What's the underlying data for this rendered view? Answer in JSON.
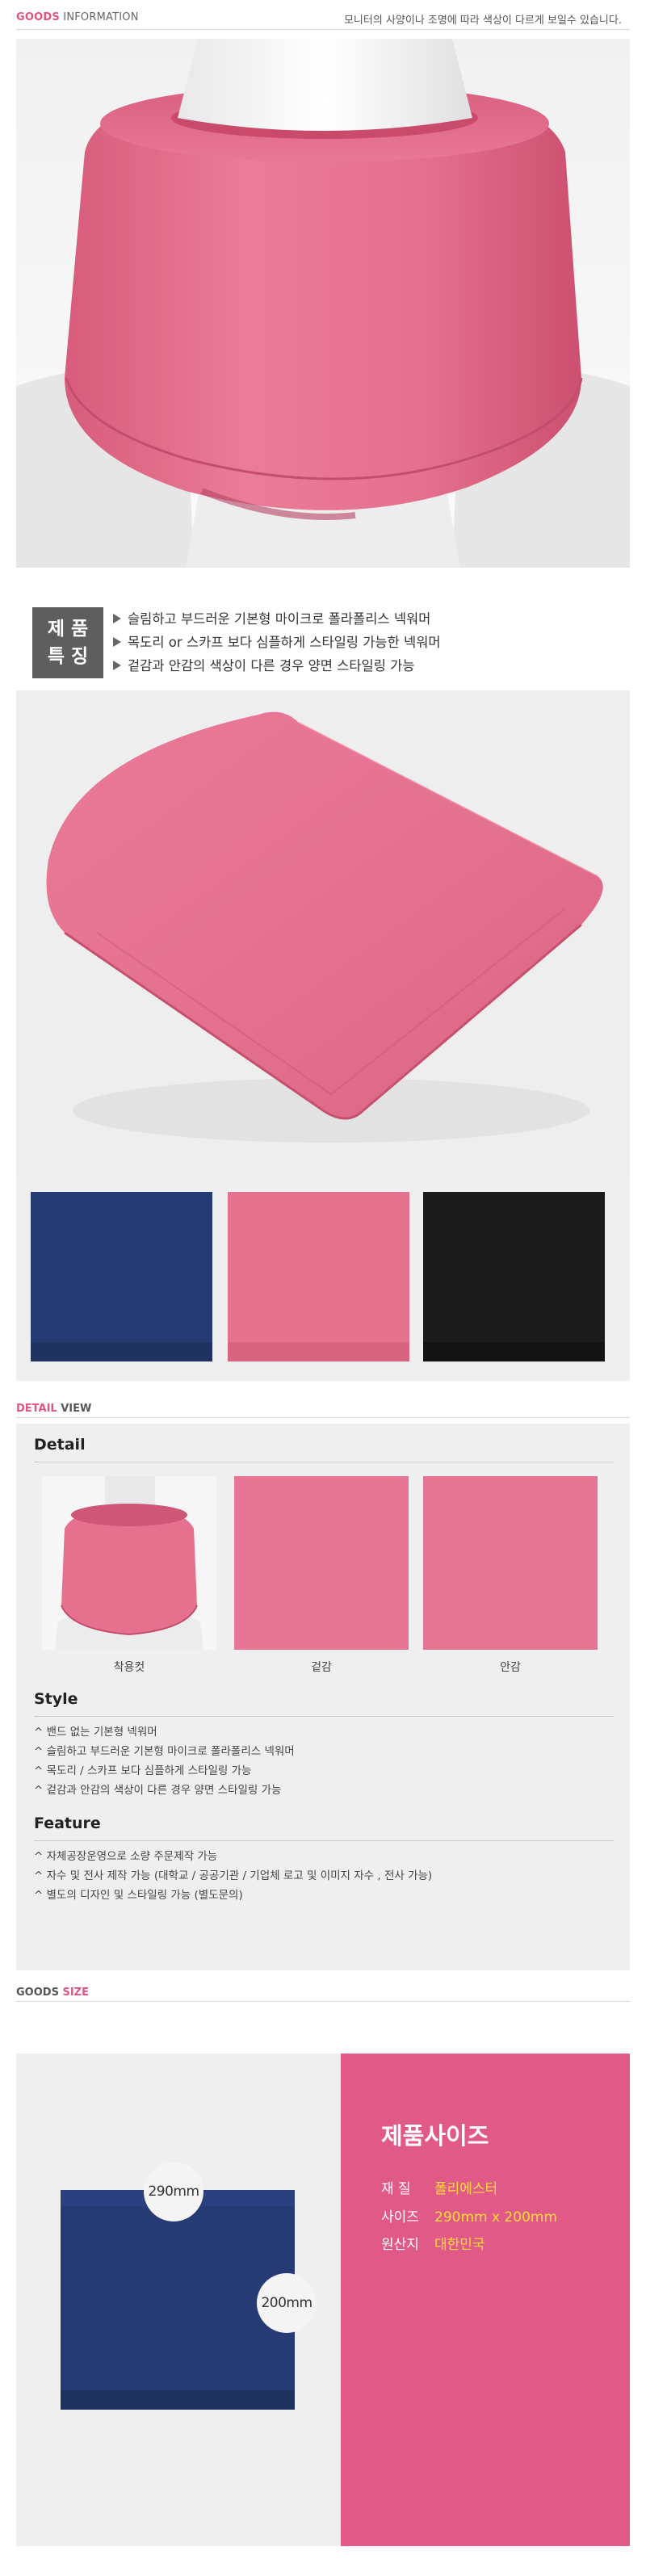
{
  "header": {
    "goods_label": "GOODS",
    "info_label": "INFORMATION",
    "notice": "모니터의 사양이나 조명에 따라 색상이 다르게 보일수 있습니다."
  },
  "features": {
    "badge_line1": "제 품",
    "badge_line2": "특 징",
    "items": [
      "슬림하고 부드러운 기본형 마이크로 폴라폴리스 넥워머",
      "목도리 or 스카프 보다 심플하게 스타일링 가능한 넥워머",
      "겉감과 안감의 색상이 다른 경우 양면 스타일링 가능"
    ]
  },
  "swatches": [
    {
      "name": "navy-swatch",
      "color": "#263a74"
    },
    {
      "name": "pink-swatch",
      "color": "#e4728f"
    },
    {
      "name": "black-swatch",
      "color": "#1b1b1b"
    }
  ],
  "detail_view": {
    "accent": "DETAIL",
    "rest": "VIEW",
    "detail_heading": "Detail",
    "captions": [
      "착용컷",
      "겉감",
      "안감"
    ],
    "style_heading": "Style",
    "style_items": [
      "^ 밴드 없는 기본형 넥워머",
      "^ 슬림하고 부드러운 기본형 마이크로 폴라폴리스 넥워머",
      "^ 목도리 / 스카프 보다 심플하게 스타일링 가능",
      "^ 겉감과 안감의 색상이 다른 경우 양면 스타일링 가능"
    ],
    "feature_heading": "Feature",
    "feature_items": [
      "^ 자체공장운영으로 소량 주문제작 가능",
      "^ 자수 및 전사 제작 가능 (대학교 / 공공기관 / 기업체 로고 및 이미지 자수 , 전사 가능)",
      "^ 별도의 디자인 및 스타일링 가능 (별도문의)"
    ]
  },
  "goods_size": {
    "goods": "GOODS",
    "size": "SIZE",
    "title": "제품사이즈",
    "specs": [
      {
        "key": "재 질",
        "value": "폴리에스터"
      },
      {
        "key": "사이즈",
        "value": "290mm x 200mm"
      },
      {
        "key": "원산지",
        "value": "대한민국"
      }
    ],
    "width_label": "290mm",
    "height_label": "200mm"
  },
  "colors": {
    "accent": "#e0557f",
    "pink_fleece": "#e4728f",
    "navy": "#263a74",
    "size_panel": "#e05987",
    "spec_value": "#ffe033"
  }
}
